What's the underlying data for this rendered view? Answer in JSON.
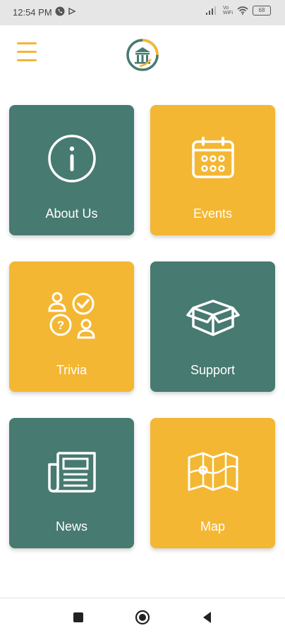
{
  "status_bar": {
    "time": "12:54 PM",
    "icons": [
      "phone-icon",
      "data-saver-icon",
      "signal-icon",
      "vowifi-icon",
      "wifi-icon",
      "battery-icon"
    ],
    "vowifi": "Vo\nWiFi",
    "battery": "68"
  },
  "header": {
    "menu_icon": "hamburger-icon",
    "logo_icon": "museum-logo-icon"
  },
  "tiles": [
    {
      "label": "About Us",
      "icon": "info-icon",
      "color": "#477a71"
    },
    {
      "label": "Events",
      "icon": "calendar-icon",
      "color": "#f4b733"
    },
    {
      "label": "Trivia",
      "icon": "trivia-icon",
      "color": "#f4b733"
    },
    {
      "label": "Support",
      "icon": "box-icon",
      "color": "#477a71"
    },
    {
      "label": "News",
      "icon": "newspaper-icon",
      "color": "#477a71"
    },
    {
      "label": "Map",
      "icon": "map-icon",
      "color": "#f4b733"
    }
  ],
  "nav_bar": {
    "buttons": [
      "recents-square-icon",
      "home-circle-icon",
      "back-triangle-icon"
    ]
  },
  "colors": {
    "teal": "#477a71",
    "yellow": "#f4b733",
    "white": "#ffffff"
  }
}
